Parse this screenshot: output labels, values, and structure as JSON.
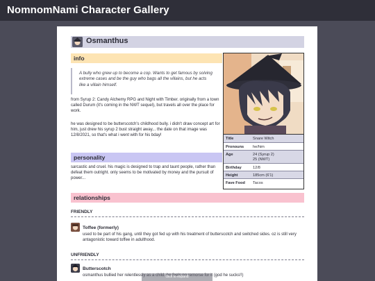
{
  "site": {
    "title": "NomnomNami Character Gallery"
  },
  "character": {
    "name": "Osmanthus",
    "portrait_icon": "character-portrait-witch-hat",
    "avatar_icon": "character-avatar"
  },
  "sections": {
    "info": "info",
    "personality": "personality",
    "relationships": "relationships"
  },
  "info": {
    "quote": "A bully who grew up to become a cop. Wants to get famous by solving extreme cases and be the guy who bags all the villains, but he acts like a villain himself.",
    "paragraph1": "from Syrup 2: Candy Alchemy RPG and Night with Timber. originally from a town called Durum (it's coming in the NWT sequel), but travels all over the place for work.",
    "paragraph2": "he was designed to be butterscotch's childhood bully. i didn't draw concept art for him, just drew his syrup 2 bust straight away... the date on that image was 12/8/2021, so that's what i went with for his bday!"
  },
  "stats": {
    "title_key": "Title",
    "title_val": "Snare Witch",
    "pronouns_key": "Pronouns",
    "pronouns_val": "he/him",
    "age_key": "Age",
    "age_val1": "24 (Syrup 2)",
    "age_val2": "25 (NWT)",
    "birthday_key": "Birthday",
    "birthday_val": "12/8",
    "height_key": "Height",
    "height_val": "185cm (6'1)",
    "food_key": "Fave Food",
    "food_val": "Tacos"
  },
  "personality": {
    "text": "sarcastic and cruel. his magic is designed to trap and taunt people, rather than defeat them outright. only seems to be motivated by money and the pursuit of power..."
  },
  "relationships": {
    "friendly_label": "FRIENDLY",
    "unfriendly_label": "UNFRIENDLY",
    "toffee": {
      "name": "Toffee (formerly)",
      "desc": "used to be part of his gang, until they got fed up with his treatment of butterscotch and switched sides. oz is still very antagonistic toward toffee in adulthood."
    },
    "butterscotch": {
      "name": "Butterscotch",
      "desc": "osmanthus bullied her relentlessly as a child. he feels no remorse for it (god he sucks!!)"
    }
  },
  "tooltip": {
    "text": "click to expand"
  },
  "colors": {
    "info_bar": "#fde4b3",
    "personality_bar": "#c9c6f3",
    "relationships_bar": "#f9c2cf",
    "header_bar": "#d3d3e3",
    "topbar": "#2f2f39",
    "background": "#4b4b58"
  }
}
